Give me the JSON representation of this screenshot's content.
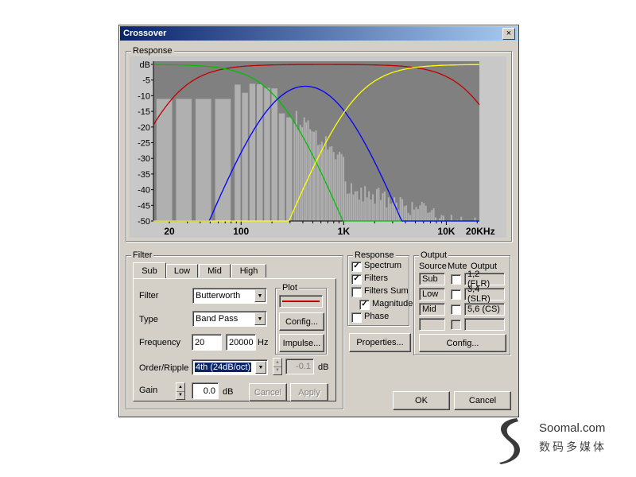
{
  "window": {
    "title": "Crossover",
    "close_glyph": "×"
  },
  "response_graph": {
    "group_label": "Response",
    "y_ticks": [
      "dB",
      "-5",
      "-10",
      "-15",
      "-20",
      "-25",
      "-30",
      "-35",
      "-40",
      "-45",
      "-50"
    ],
    "x_ticks": [
      "20",
      "100",
      "1K",
      "10K",
      "20KHz"
    ],
    "colors": {
      "background": "#808080",
      "spectrum": "#b0b0b0",
      "sub": "#c00000",
      "low": "#00c000",
      "mid": "#0000ff",
      "high": "#ffff00"
    }
  },
  "filter": {
    "group_label": "Filter",
    "tabs": [
      "Sub",
      "Low",
      "Mid",
      "High"
    ],
    "active_tab": "Sub",
    "filter_label": "Filter",
    "filter_value": "Butterworth",
    "type_label": "Type",
    "type_value": "Band Pass",
    "frequency_label": "Frequency",
    "freq_low": "20",
    "freq_high": "20000",
    "freq_unit": "Hz",
    "order_label": "Order/Ripple",
    "order_value": "4th (24dB/oct)",
    "ripple_value": "-0.1",
    "ripple_unit": "dB",
    "gain_label": "Gain",
    "gain_value": "0.0",
    "gain_unit": "dB",
    "cancel_label": "Cancel",
    "apply_label": "Apply",
    "plot": {
      "group_label": "Plot",
      "config_label": "Config...",
      "impulse_label": "Impulse..."
    }
  },
  "response_opts": {
    "group_label": "Response",
    "items": [
      {
        "label": "Spectrum",
        "checked": true
      },
      {
        "label": "Filters",
        "checked": true
      },
      {
        "label": "Filters Sum",
        "checked": false
      },
      {
        "label": "Magnitude",
        "checked": true
      },
      {
        "label": "Phase",
        "checked": false
      }
    ],
    "properties_label": "Properties..."
  },
  "output": {
    "group_label": "Output",
    "headers": {
      "source": "Source",
      "mute": "Mute",
      "output": "Output"
    },
    "rows": [
      {
        "source": "Sub",
        "muted": false,
        "output": "1,2 (FLR)"
      },
      {
        "source": "Low",
        "muted": false,
        "output": "3,4 (SLR)"
      },
      {
        "source": "Mid",
        "muted": false,
        "output": "5,6 (CS)"
      },
      {
        "source": "",
        "muted": false,
        "output": ""
      }
    ],
    "config_label": "Config..."
  },
  "dialog": {
    "ok_label": "OK",
    "cancel_label": "Cancel"
  },
  "watermark": {
    "site": "Soomal.com",
    "tagline": "数码多媒体"
  }
}
